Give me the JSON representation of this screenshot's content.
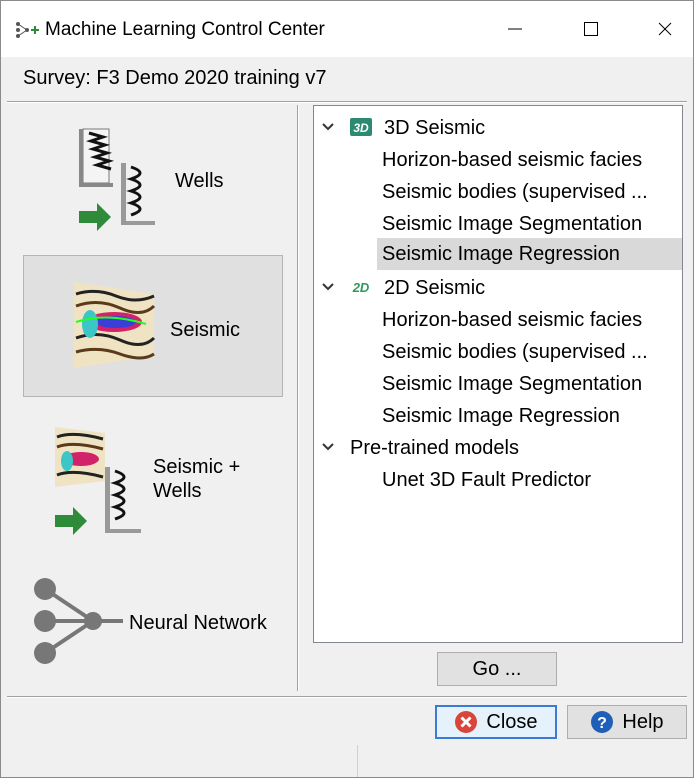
{
  "window": {
    "title": "Machine Learning Control Center"
  },
  "survey": {
    "label": "Survey: F3 Demo 2020 training v7"
  },
  "categories": [
    {
      "label": "Wells"
    },
    {
      "label": "Seismic"
    },
    {
      "label_line1": "Seismic +",
      "label_line2": "Wells"
    },
    {
      "label": "Neural Network"
    }
  ],
  "tree": {
    "groups": [
      {
        "label": "3D Seismic",
        "badge": "3D",
        "items": [
          "Horizon-based seismic facies",
          "Seismic bodies (supervised ...",
          "Seismic Image Segmentation",
          "Seismic Image Regression"
        ]
      },
      {
        "label": "2D Seismic",
        "badge": "2D",
        "items": [
          "Horizon-based seismic facies",
          "Seismic bodies (supervised ...",
          "Seismic Image Segmentation",
          "Seismic Image Regression"
        ]
      },
      {
        "label": "Pre-trained models",
        "items": [
          "Unet 3D Fault Predictor"
        ]
      }
    ]
  },
  "buttons": {
    "go": "Go ...",
    "close": "Close",
    "help": "Help"
  },
  "colors": {
    "accent": "#3b7bd8",
    "selection": "#d9d9d9",
    "close_icon": "#d9453a",
    "help_icon": "#1f5fb8",
    "arrow_green": "#2e8b3a"
  }
}
